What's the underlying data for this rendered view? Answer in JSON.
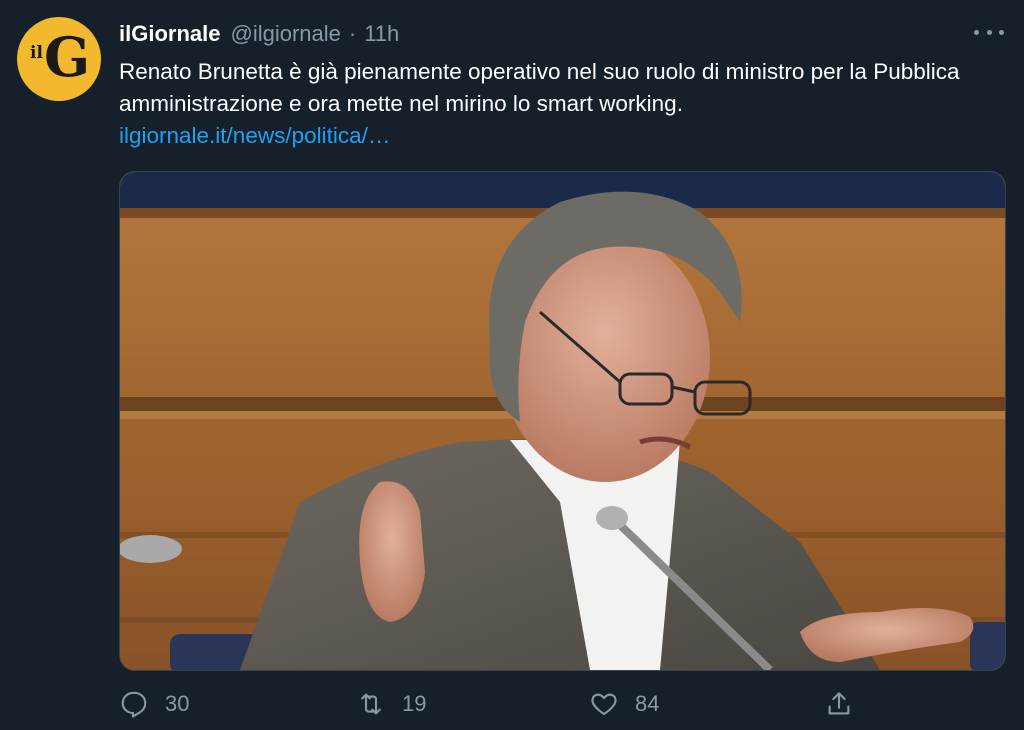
{
  "tweet": {
    "author_name": "ilGiornale",
    "author_handle": "@ilgiornale",
    "separator": "·",
    "time": "11h",
    "avatar_logo_text": "ilG",
    "text": "Renato Brunetta è già pienamente operativo nel suo ruolo di ministro per la Pubblica amministrazione e ora mette nel mirino lo smart working.",
    "link_text": "ilgiornale.it/news/politica/…",
    "media_icon": "photo-man-at-microphone"
  },
  "actions": {
    "reply_count": "30",
    "retweet_count": "19",
    "like_count": "84",
    "reply_icon": "reply-icon",
    "retweet_icon": "retweet-icon",
    "like_icon": "heart-icon",
    "share_icon": "share-icon"
  },
  "colors": {
    "background": "#15202b",
    "secondary_text": "#8899a6",
    "link": "#1da1f2",
    "avatar_bg": "#f2b92f"
  }
}
